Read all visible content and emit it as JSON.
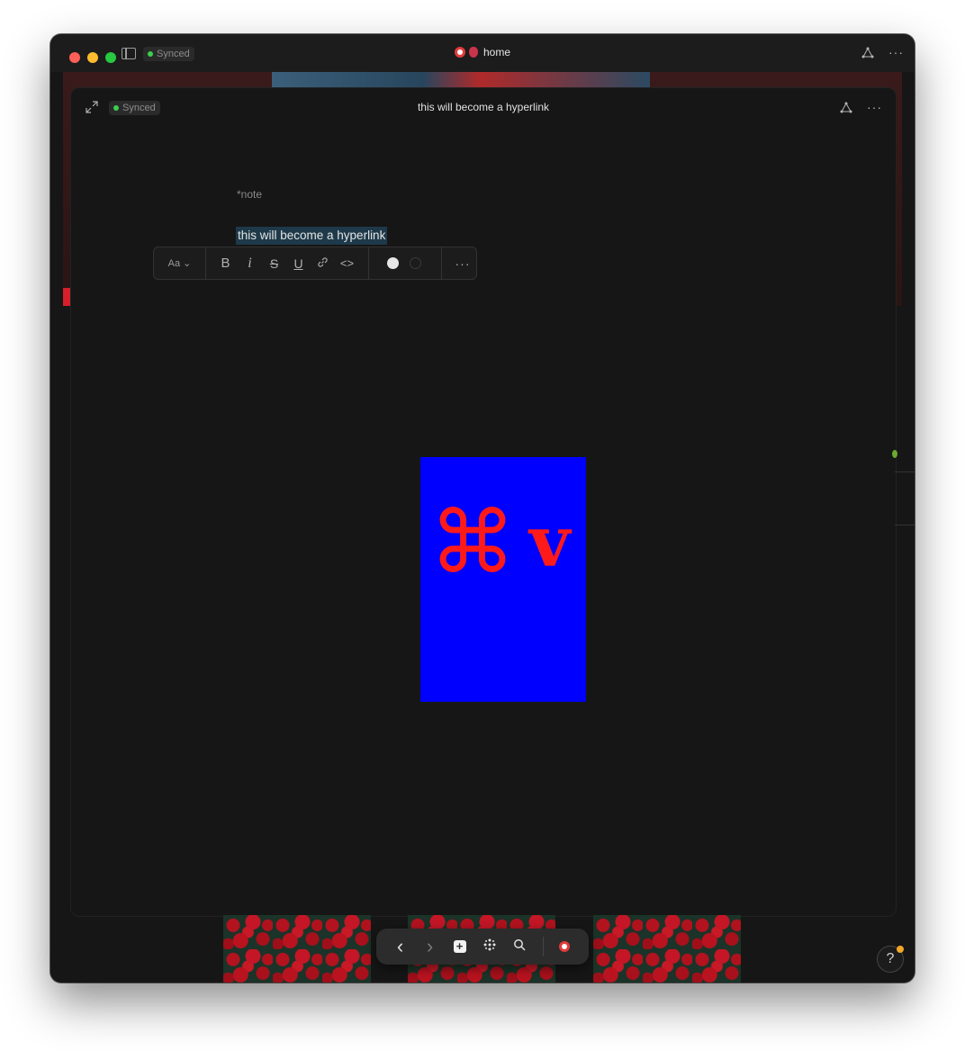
{
  "window": {
    "sync_status": "Synced",
    "title": "home",
    "title_emojis": [
      "alarm-clock-emoji",
      "anatomical-heart-emoji"
    ]
  },
  "note": {
    "sync_status": "Synced",
    "title": "this will become a hyperlink",
    "tag": "*note",
    "selected_text": "this will become a hyperlink"
  },
  "format_toolbar": {
    "text_style_label": "Aa",
    "bold": "B",
    "italic": "i",
    "strikethrough": "S",
    "underline": "U",
    "more": "···",
    "colors": [
      "#e6e6e6",
      "#1c1c1c"
    ]
  },
  "image": {
    "command_glyph": "⌘",
    "key_glyph": "v",
    "background": "#0000ff",
    "glyph_color": "#ff1a1a"
  },
  "nav": {
    "back": "‹",
    "forward": "›",
    "help": "?"
  }
}
